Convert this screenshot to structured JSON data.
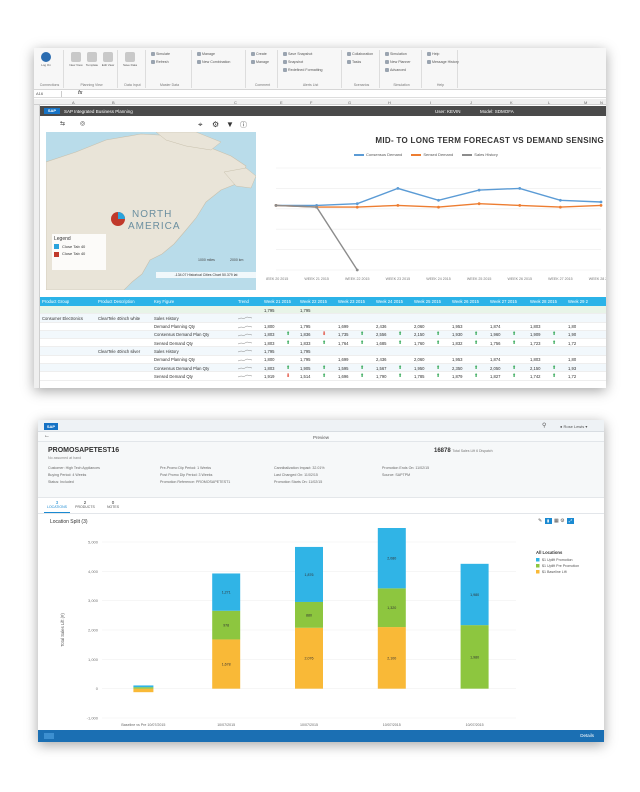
{
  "excel": {
    "ribbon_groups": [
      {
        "title": "Connections",
        "buttons": [
          "Log On"
        ]
      },
      {
        "title": "Planning View",
        "buttons": [
          "New View",
          "Template",
          "Edit View"
        ]
      },
      {
        "title": "Data Input",
        "buttons": [
          "Save Data"
        ]
      },
      {
        "title": "Master Data",
        "small": [
          "Simulate",
          "Refresh"
        ]
      },
      {
        "title": "",
        "small": [
          "Manage",
          "New Combination"
        ]
      },
      {
        "title": "Comment",
        "small": [
          "Create",
          "Manage"
        ]
      },
      {
        "title": "Alerts List",
        "small": [
          "Save Snapshot",
          "Snapshot",
          "Redefined Formatting"
        ]
      },
      {
        "title": "Scenarios",
        "small": [
          "Collaboration",
          "Tasks"
        ]
      },
      {
        "title": "Simulation",
        "small": [
          "Simulation",
          "New Planner",
          "Advanced"
        ]
      },
      {
        "title": "Help",
        "small": [
          "Help",
          "Message History"
        ]
      }
    ],
    "formula_bar": {
      "name_box": "A16",
      "fx": "fx"
    },
    "columns": [
      "A",
      "B",
      "C",
      "E",
      "F",
      "G",
      "H",
      "I",
      "J",
      "K",
      "L",
      "M",
      "N"
    ],
    "rows": [
      "1",
      "2",
      "3",
      "4",
      "5",
      "6",
      "7",
      "8",
      "9",
      "10",
      "11",
      "12",
      "13",
      "14",
      "15",
      "16",
      "17",
      "18",
      "19",
      "20",
      "21",
      "22",
      "23",
      "24",
      "25",
      "26",
      "27"
    ],
    "sap_bar": {
      "logo": "SAP",
      "title": "SAP Integrated Business Planning",
      "user": "User: KEVIN",
      "model": "Model: SDMOFA"
    },
    "map": {
      "legend_title": "Legend",
      "legend_items": [
        {
          "label": "Close Tab 40",
          "color": "#2aa3dc"
        },
        {
          "label": "Close Tab 40",
          "color": "#c0392b"
        }
      ],
      "label_north": "NORTH",
      "label_america": "AMERICA",
      "scale_left": "1000 miles",
      "scale_right": "2000 km",
      "coords": "-134.07 Historical Cities  Chart  50.379 lat",
      "tools": [
        "route-icon",
        "lasso-icon",
        "location-pin-icon",
        "gear-icon",
        "filter-icon",
        "help-icon"
      ]
    },
    "chart_data": {
      "type": "line",
      "title": "MID- TO LONG TERM FORECAST VS DEMAND SENSING",
      "categories": [
        "WEEK 20 2015",
        "WEEK 21 2015",
        "WEEK 22 2015",
        "WEEK 23 2015",
        "WEEK 24 2015",
        "WEEK 25 2015",
        "WEEK 26 2015",
        "WEEK 27 2015",
        "WEEK 28 2015"
      ],
      "series": [
        {
          "name": "Consensus Demand",
          "color": "#5b9bd5",
          "values": [
            1900,
            1900,
            1950,
            2400,
            2050,
            2350,
            2400,
            2050,
            2000
          ]
        },
        {
          "name": "Sensed Demand",
          "color": "#ed7d31",
          "values": [
            1900,
            1850,
            1850,
            1900,
            1850,
            1950,
            1900,
            1850,
            1900
          ]
        },
        {
          "name": "Sales History",
          "color": "#8c8c8c",
          "values": [
            1900,
            1850,
            0,
            null,
            null,
            null,
            null,
            null,
            null
          ]
        }
      ],
      "ylim": [
        0,
        3000
      ],
      "grid": true,
      "legend": "top"
    },
    "grid": {
      "headers": [
        "Product Group",
        "Product Description",
        "Key Figure",
        "Trend",
        "Week 21 2015",
        "Week 22 2015",
        "Week 23 2015",
        "Week 24 2015",
        "Week 25 2015",
        "Week 26 2015",
        "Week 27 2015",
        "Week 28 2015",
        "Week 29 2"
      ],
      "rows": [
        {
          "group": "",
          "desc": "",
          "kf": "",
          "arrow": "",
          "vals": [
            "1,795",
            "1,795",
            "",
            "",
            "",
            "",
            "",
            "",
            ""
          ],
          "highlight": true
        },
        {
          "group": "Consumer Electronics",
          "desc": "ClearTele 40inch white",
          "kf": "Sales History",
          "arrow": "",
          "vals": [
            "",
            "",
            "",
            "",
            "",
            "",
            "",
            "",
            ""
          ]
        },
        {
          "group": "",
          "desc": "",
          "kf": "Demand Planning Qty",
          "arrow": "",
          "vals": [
            "1,800",
            "1,795",
            "1,699",
            "2,436",
            "2,060",
            "1,953",
            "1,874",
            "1,803",
            "1,80"
          ]
        },
        {
          "group": "",
          "desc": "",
          "kf": "Consensus Demand Plan Qty",
          "arrow": "up",
          "vals": [
            "1,803",
            "1,836",
            "1,735",
            "2,556",
            "2,150",
            "1,930",
            "1,960",
            "1,909",
            "1,90"
          ]
        },
        {
          "group": "",
          "desc": "",
          "kf": "Sensed Demand Qty",
          "arrow": "up",
          "vals": [
            "1,803",
            "1,833",
            "1,764",
            "1,685",
            "1,760",
            "1,832",
            "1,756",
            "1,723",
            "1,72"
          ]
        },
        {
          "group": "",
          "desc": "ClearTele 40inch silver",
          "kf": "Sales History",
          "arrow": "",
          "vals": [
            "1,795",
            "1,795",
            "",
            "",
            "",
            "",
            "",
            "",
            ""
          ]
        },
        {
          "group": "",
          "desc": "",
          "kf": "Demand Planning Qty",
          "arrow": "",
          "vals": [
            "1,800",
            "1,795",
            "1,699",
            "2,436",
            "2,060",
            "1,953",
            "1,874",
            "1,803",
            "1,80"
          ]
        },
        {
          "group": "",
          "desc": "",
          "kf": "Consensus Demand Plan Qty",
          "arrow": "up",
          "vals": [
            "1,803",
            "1,905",
            "1,595",
            "1,567",
            "1,950",
            "2,350",
            "2,050",
            "2,150",
            "1,93"
          ]
        },
        {
          "group": "",
          "desc": "",
          "kf": "Sensed Demand Qty",
          "arrow": "up",
          "vals": [
            "1,919",
            "1,514",
            "1,696",
            "1,790",
            "1,785",
            "1,879",
            "1,827",
            "1,742",
            "1,72"
          ]
        }
      ]
    }
  },
  "fiori": {
    "shell": {
      "logo": "SAP",
      "user": "Rose Lewis"
    },
    "page_title": "Preview",
    "promo_name": "PROMOSAPETEST16",
    "promo_sub": "No assumed at hand",
    "kpi_value": "16878",
    "kpi_label": "Total Sales Lift 6 Dispatch",
    "attributes": [
      [
        "Customer: High Tech Appliances",
        "Buying Period: 4 Weeks",
        "Status: Included"
      ],
      [
        "Pre-Promo Dip Period: 1 Weeks",
        "Post Promo Dip Period: 3 Weeks",
        "Promotion Reference: PROMOSAPETEST1"
      ],
      [
        "Cannibalization Impact: 32.01%",
        "Last Changed On: 11/02/15",
        "Promotion Starts On: 11/02/15"
      ],
      [
        "Promotion Ends On: 11/02/15",
        "Source: SAPTPM"
      ]
    ],
    "tabs": [
      {
        "count": "3",
        "label": "LOCATIONS"
      },
      {
        "count": "2",
        "label": "PRODUCTS"
      },
      {
        "count": "0",
        "label": "NOTES"
      }
    ],
    "panel_title": "Location Split (3)",
    "footer_label": "Details",
    "chart_data": {
      "type": "bar",
      "stacked": true,
      "title": "",
      "ylabel": "Total Sales Lift (#)",
      "categories": [
        "Baseline vs Pre 10/07/2015",
        "10/07/2015",
        "10/07/2015",
        "10/07/2015",
        "10/07/2015"
      ],
      "series": [
        {
          "name": "$1 Baseline Lift",
          "color": "#f9b937",
          "values": [
            -120,
            1678,
            2076,
            2100,
            0
          ]
        },
        {
          "name": "$1 Uplift Pre Promotion",
          "color": "#8dc63f",
          "values": [
            50,
            978,
            880,
            1320,
            2166
          ]
        },
        {
          "name": "$1 Uplift Promotion",
          "color": "#30b4e6",
          "values": [
            60,
            1271,
            1876,
            2080,
            2090
          ]
        }
      ],
      "segment_labels": [
        [
          "",
          "1,678",
          "2,076",
          "2,100",
          ""
        ],
        [
          "",
          "978",
          "880",
          "1,320",
          "1,980"
        ],
        [
          "",
          "1,271",
          "1,876",
          "2,080",
          "1,980"
        ]
      ],
      "yticks": [
        "-1,000",
        "0",
        "1,000",
        "2,000",
        "3,000",
        "4,000",
        "5,000"
      ],
      "ylim": [
        -1000,
        5000
      ],
      "legend_title": "All Locations",
      "legend": "right"
    }
  }
}
